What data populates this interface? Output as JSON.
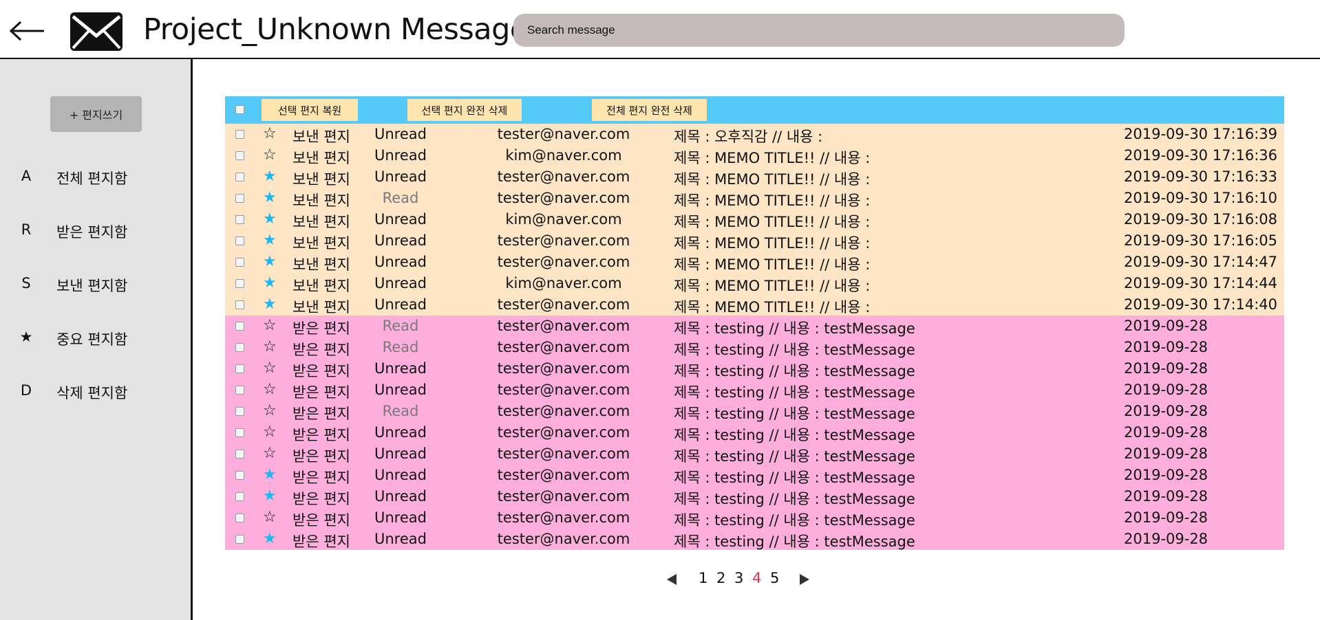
{
  "header": {
    "title": "Project_Unknown Message",
    "search_placeholder": "Search message"
  },
  "sidebar": {
    "compose_label": "+ 편지쓰기",
    "items": [
      {
        "key": "A",
        "label": "전체 편지함"
      },
      {
        "key": "R",
        "label": "받은 편지함"
      },
      {
        "key": "S",
        "label": "보낸 편지함"
      },
      {
        "key": "★",
        "label": "중요 편지함"
      },
      {
        "key": "D",
        "label": "삭제 편지함"
      }
    ]
  },
  "toolbar": {
    "restore_label": "선택 편지 복원",
    "delete_selected_label": "선택 편지 완전 삭제",
    "delete_all_label": "전체 편지 완전 삭제"
  },
  "colors": {
    "toolbar": "#55c9f7",
    "sent_row": "#fde5c5",
    "received_row": "#fdaedc",
    "star_active": "#1fb7ec",
    "active_page": "#e8334a"
  },
  "messages": [
    {
      "star": "☆",
      "starred": false,
      "kind": "보낸 편지",
      "status": "Unread",
      "email": "tester@naver.com",
      "subject": "제목 : 오후직감   //   내용 :",
      "date": "2019-09-30 17:16:39"
    },
    {
      "star": "☆",
      "starred": false,
      "kind": "보낸 편지",
      "status": "Unread",
      "email": "kim@naver.com",
      "subject": "제목 : MEMO TITLE!!   //   내용 :",
      "date": "2019-09-30 17:16:36"
    },
    {
      "star": "★",
      "starred": true,
      "kind": "보낸 편지",
      "status": "Unread",
      "email": "tester@naver.com",
      "subject": "제목 : MEMO TITLE!!   //   내용 :",
      "date": "2019-09-30 17:16:33"
    },
    {
      "star": "★",
      "starred": true,
      "kind": "보낸 편지",
      "status": "Read",
      "email": "tester@naver.com",
      "subject": "제목 : MEMO TITLE!!   //   내용 :",
      "date": "2019-09-30 17:16:10"
    },
    {
      "star": "★",
      "starred": true,
      "kind": "보낸 편지",
      "status": "Unread",
      "email": "kim@naver.com",
      "subject": "제목 : MEMO TITLE!!   //   내용 :",
      "date": "2019-09-30 17:16:08"
    },
    {
      "star": "★",
      "starred": true,
      "kind": "보낸 편지",
      "status": "Unread",
      "email": "tester@naver.com",
      "subject": "제목 : MEMO TITLE!!   //   내용 :",
      "date": "2019-09-30 17:16:05"
    },
    {
      "star": "★",
      "starred": true,
      "kind": "보낸 편지",
      "status": "Unread",
      "email": "tester@naver.com",
      "subject": "제목 : MEMO TITLE!!   //   내용 :",
      "date": "2019-09-30 17:14:47"
    },
    {
      "star": "★",
      "starred": true,
      "kind": "보낸 편지",
      "status": "Unread",
      "email": "kim@naver.com",
      "subject": "제목 : MEMO TITLE!!   //   내용 :",
      "date": "2019-09-30 17:14:44"
    },
    {
      "star": "★",
      "starred": true,
      "kind": "보낸 편지",
      "status": "Unread",
      "email": "tester@naver.com",
      "subject": "제목 : MEMO TITLE!!   //   내용 :",
      "date": "2019-09-30 17:14:40"
    },
    {
      "star": "☆",
      "starred": false,
      "kind": "받은 편지",
      "status": "Read",
      "email": "tester@naver.com",
      "subject": "제목 : testing   //   내용 : testMessage",
      "date": "2019-09-28"
    },
    {
      "star": "☆",
      "starred": false,
      "kind": "받은 편지",
      "status": "Read",
      "email": "tester@naver.com",
      "subject": "제목 : testing   //   내용 : testMessage",
      "date": "2019-09-28"
    },
    {
      "star": "☆",
      "starred": false,
      "kind": "받은 편지",
      "status": "Unread",
      "email": "tester@naver.com",
      "subject": "제목 : testing   //   내용 : testMessage",
      "date": "2019-09-28"
    },
    {
      "star": "☆",
      "starred": false,
      "kind": "받은 편지",
      "status": "Unread",
      "email": "tester@naver.com",
      "subject": "제목 : testing   //   내용 : testMessage",
      "date": "2019-09-28"
    },
    {
      "star": "☆",
      "starred": false,
      "kind": "받은 편지",
      "status": "Read",
      "email": "tester@naver.com",
      "subject": "제목 : testing   //   내용 : testMessage",
      "date": "2019-09-28"
    },
    {
      "star": "☆",
      "starred": false,
      "kind": "받은 편지",
      "status": "Unread",
      "email": "tester@naver.com",
      "subject": "제목 : testing   //   내용 : testMessage",
      "date": "2019-09-28"
    },
    {
      "star": "☆",
      "starred": false,
      "kind": "받은 편지",
      "status": "Unread",
      "email": "tester@naver.com",
      "subject": "제목 : testing   //   내용 : testMessage",
      "date": "2019-09-28"
    },
    {
      "star": "★",
      "starred": true,
      "kind": "받은 편지",
      "status": "Unread",
      "email": "tester@naver.com",
      "subject": "제목 : testing   //   내용 : testMessage",
      "date": "2019-09-28"
    },
    {
      "star": "★",
      "starred": true,
      "kind": "받은 편지",
      "status": "Unread",
      "email": "tester@naver.com",
      "subject": "제목 : testing   //   내용 : testMessage",
      "date": "2019-09-28"
    },
    {
      "star": "☆",
      "starred": false,
      "kind": "받은 편지",
      "status": "Unread",
      "email": "tester@naver.com",
      "subject": "제목 : testing   //   내용 : testMessage",
      "date": "2019-09-28"
    },
    {
      "star": "★",
      "starred": true,
      "kind": "받은 편지",
      "status": "Unread",
      "email": "tester@naver.com",
      "subject": "제목 : testing   //   내용 : testMessage",
      "date": "2019-09-28"
    }
  ],
  "pagination": {
    "pages": [
      "1",
      "2",
      "3",
      "4",
      "5"
    ],
    "current": "4"
  }
}
